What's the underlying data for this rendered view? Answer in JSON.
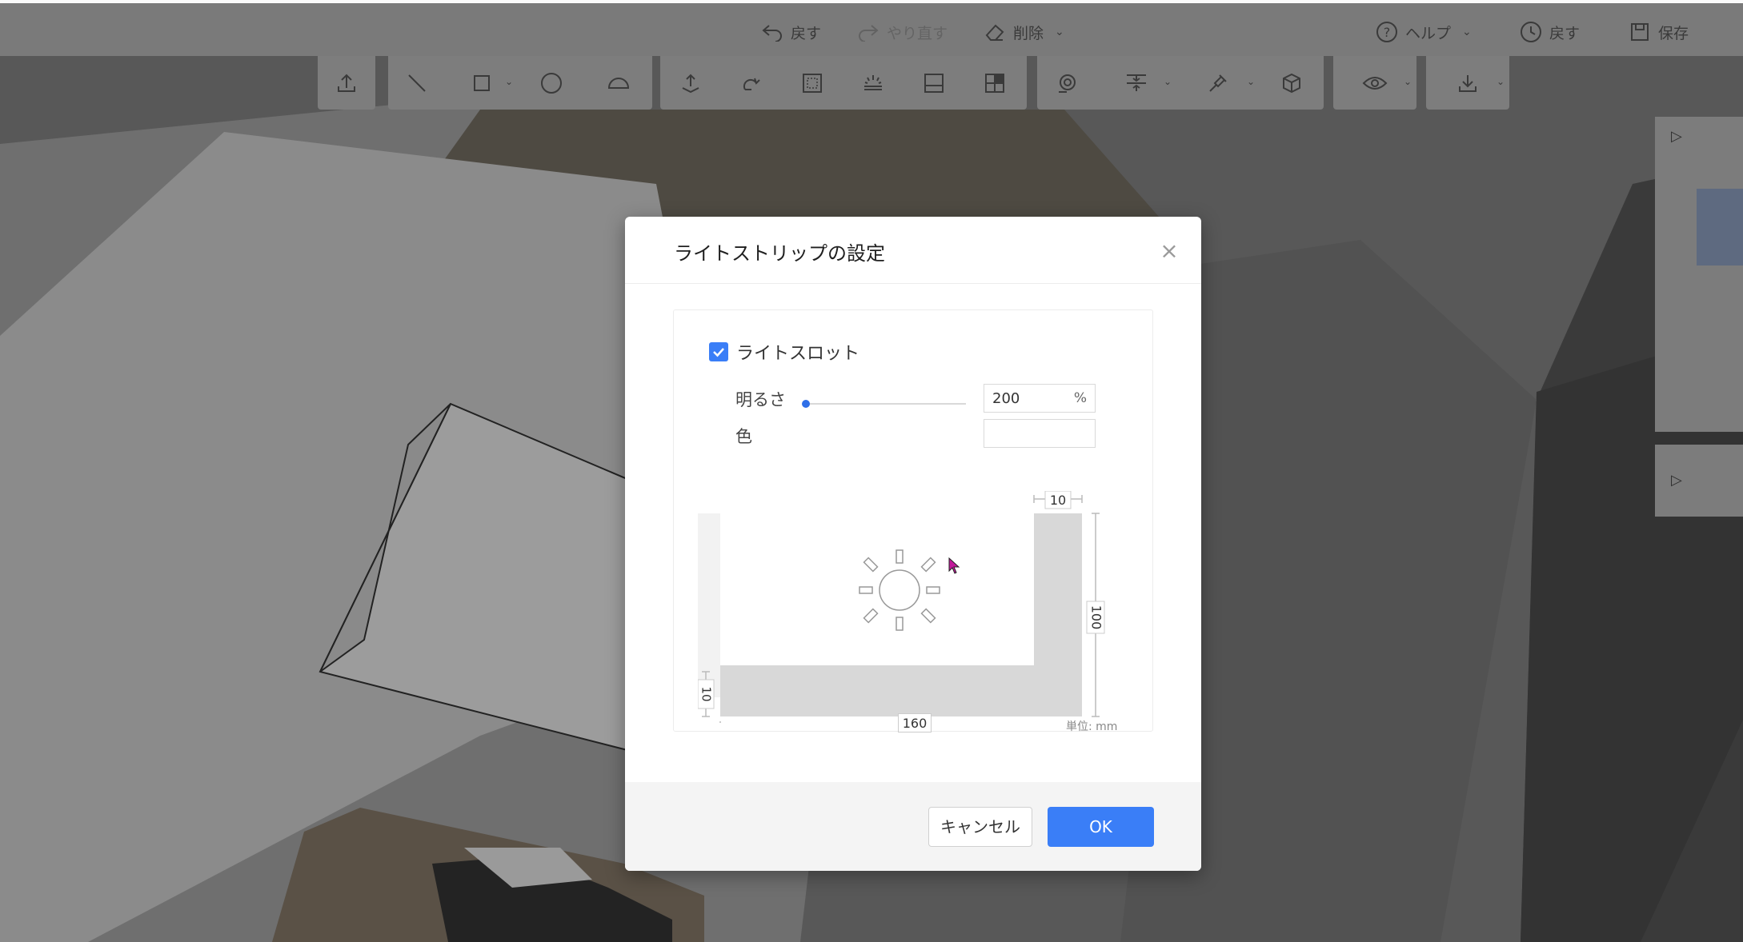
{
  "header": {
    "undo_label": "戻す",
    "redo_label": "やり直す",
    "delete_label": "削除",
    "help_label": "ヘルプ",
    "history_label": "戻す",
    "save_label": "保存"
  },
  "toolbar": {
    "icons": [
      "upload-icon",
      "line-icon",
      "rectangle-icon",
      "circle-icon",
      "arc-icon",
      "push-pull-icon",
      "rotate-icon",
      "frame-icon",
      "light-strip-icon",
      "panel-icon",
      "split-panel-icon",
      "search-zoom-icon",
      "align-icon",
      "paint-brush-icon",
      "cube-icon",
      "eye-icon",
      "download-icon"
    ]
  },
  "dialog": {
    "title": "ライトストリップの設定",
    "checkbox_label": "ライトスロット",
    "checkbox_checked": true,
    "brightness_label": "明るさ",
    "brightness_value": "200",
    "brightness_unit": "%",
    "brightness_slider_fraction": 0.0,
    "color_label": "色",
    "color_value": "",
    "dims": {
      "top_width": "10",
      "height": "100",
      "bottom_thickness": "10",
      "width": "160"
    },
    "unit_note": "単位: mm",
    "cancel_label": "キャンセル",
    "ok_label": "OK"
  },
  "colors": {
    "accent": "#3a7ef7",
    "overlay_dim": "#5a5a5a"
  }
}
